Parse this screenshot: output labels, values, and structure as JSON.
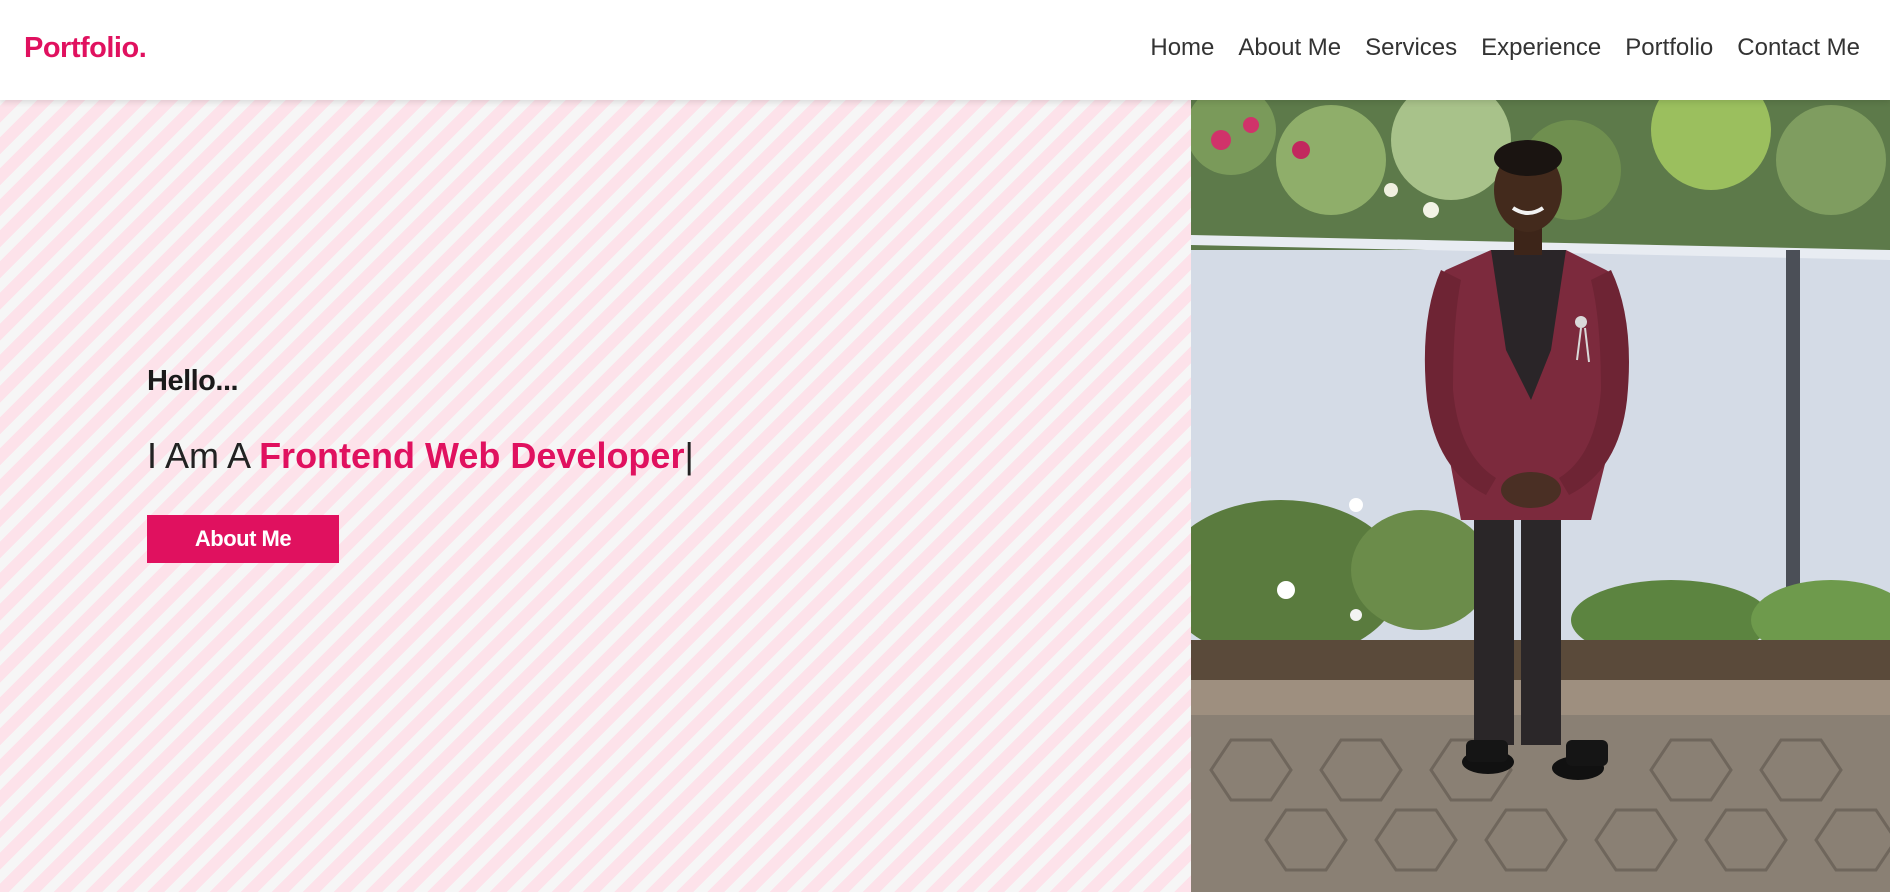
{
  "header": {
    "logo": "Portfolio.",
    "nav": [
      {
        "label": "Home"
      },
      {
        "label": "About Me"
      },
      {
        "label": "Services"
      },
      {
        "label": "Experience"
      },
      {
        "label": "Portfolio"
      },
      {
        "label": "Contact Me"
      }
    ]
  },
  "hero": {
    "greeting": "Hello...",
    "intro_prefix": "I Am A ",
    "role": "Frontend Web Developer",
    "cursor": "|",
    "button_label": "About Me"
  },
  "colors": {
    "accent": "#e0115f",
    "stripe_pink": "#fde2ea",
    "stripe_light": "#f6f6f6",
    "text_dark": "#222222"
  }
}
